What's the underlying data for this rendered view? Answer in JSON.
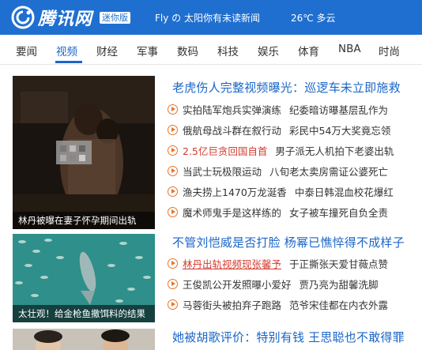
{
  "header": {
    "brand": "腾讯网",
    "edition_badge": "迷你版",
    "user": "Fly の 太阳",
    "news_notice": "你有未读新闻",
    "weather": "26℃  多云",
    "bar_color": "#1f6fd0"
  },
  "nav": {
    "items": [
      "要闻",
      "视频",
      "财经",
      "军事",
      "数码",
      "科技",
      "娱乐",
      "体育",
      "NBA",
      "时尚"
    ],
    "active_index": 1,
    "active_color": "#1a66c8"
  },
  "blocks": [
    {
      "thumb_caption": "林丹被曝在妻子怀孕期间出轨",
      "headline": "老虎伤人完整视频曝光：巡逻车未立即施救",
      "lines": [
        [
          "实拍陆军炮兵实弹演练",
          "纪委暗访曝基层乱作为"
        ],
        [
          "俄航母战斗群在叙行动",
          "彩民中54万大奖竟忘领"
        ],
        [
          "2.5亿巨贪回国自首",
          "男子派无人机拍下老婆出轨"
        ],
        [
          "当武士玩极限运动",
          "八旬老太卖房需证公婆死亡"
        ],
        [
          "渔夫捞上1470万龙涎香",
          "中泰日韩混血校花爆红"
        ],
        [
          "魔术师鬼手是这样练的",
          "女子被车撞死自负全责"
        ]
      ]
    },
    {
      "thumb_caption": "太壮观！给金枪鱼撒饵料的结果",
      "headline": "不管刘恺威是否打脸 杨幂已憔悴得不成样子",
      "lines": [
        [
          "林丹出轨视频现张馨予",
          "于正撕张天爱甘薇点赞"
        ],
        [
          "王俊凯公开发照曝小爱好",
          "贾乃亮为甜馨洗脚"
        ],
        [
          "马蓉街头被拍弃子跑路",
          "范爷宋佳都在内衣外露"
        ]
      ]
    },
    {
      "headline": "她被胡歌评价：特别有钱 王思聪也不敢得罪"
    }
  ],
  "icons": [
    "qq-logo-icon",
    "play-icon"
  ]
}
